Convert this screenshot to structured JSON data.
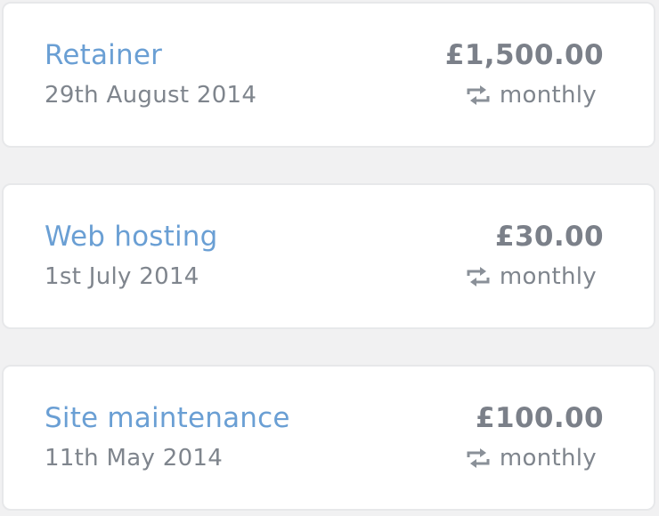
{
  "colors": {
    "title": "#6a9fd4",
    "text_muted": "#7f858d",
    "amount": "#7b8089",
    "card_border": "#e7e8ea",
    "background": "#f1f1f2"
  },
  "items": [
    {
      "title": "Retainer",
      "date": "29th August 2014",
      "amount": "£1,500.00",
      "frequency": "monthly",
      "frequency_icon": "repeat-icon"
    },
    {
      "title": "Web hosting",
      "date": "1st July 2014",
      "amount": "£30.00",
      "frequency": "monthly",
      "frequency_icon": "repeat-icon"
    },
    {
      "title": "Site maintenance",
      "date": "11th May 2014",
      "amount": "£100.00",
      "frequency": "monthly",
      "frequency_icon": "repeat-icon"
    }
  ]
}
